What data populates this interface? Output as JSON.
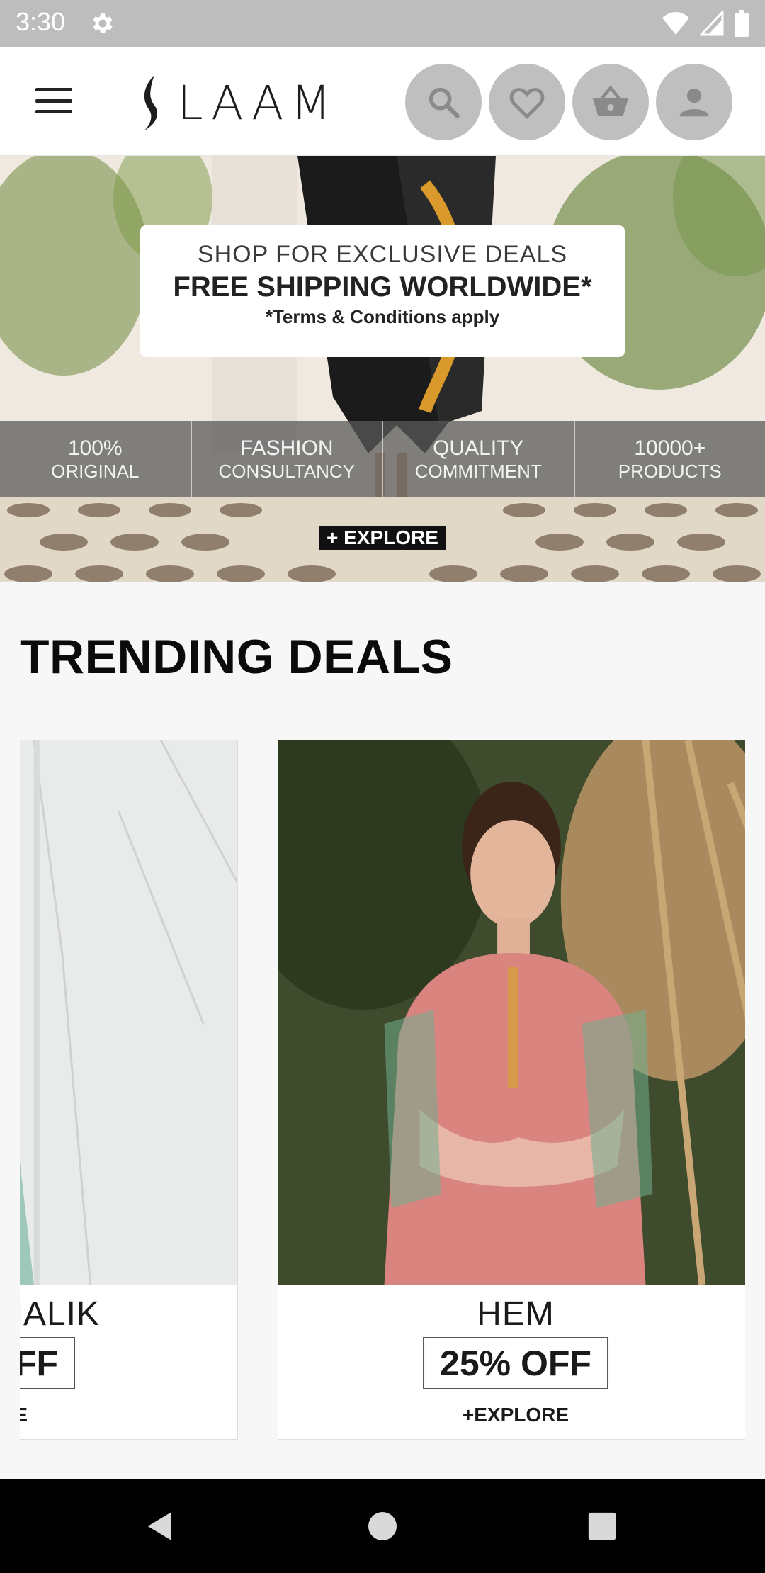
{
  "status_bar": {
    "time": "3:30",
    "icons": [
      "settings-icon",
      "wifi-icon",
      "signal-icon",
      "battery-icon"
    ]
  },
  "header": {
    "logo_text": "LAAM",
    "icons": [
      "menu-icon",
      "search-icon",
      "heart-icon",
      "basket-icon",
      "account-icon"
    ]
  },
  "banner": {
    "promo_line1": "SHOP FOR EXCLUSIVE DEALS",
    "promo_line2": "FREE SHIPPING WORLDWIDE*",
    "promo_line3": "*Terms & Conditions apply",
    "features": [
      {
        "line1": "100%",
        "line2": "ORIGINAL"
      },
      {
        "line1": "FASHION",
        "line2": "CONSULTANCY"
      },
      {
        "line1": "QUALITY",
        "line2": "COMMITMENT"
      },
      {
        "line1": "10000+",
        "line2": "PRODUCTS"
      }
    ],
    "explore_label": "+ EXPLORE"
  },
  "trending": {
    "title": "TRENDING DEALS",
    "cards": [
      {
        "brand": "MALIK",
        "discount": "FF",
        "explore": "E"
      },
      {
        "brand": "HEM",
        "discount": "25% OFF",
        "explore": "+EXPLORE"
      }
    ]
  },
  "nav_bar": {
    "icons": [
      "back-icon",
      "home-icon",
      "recents-icon"
    ]
  },
  "colors": {
    "status_bar": "#bdbdbd",
    "header_icon_bg": "#bfbfbf",
    "page_bg": "#f7f7f7",
    "nav_bar": "#000000"
  }
}
